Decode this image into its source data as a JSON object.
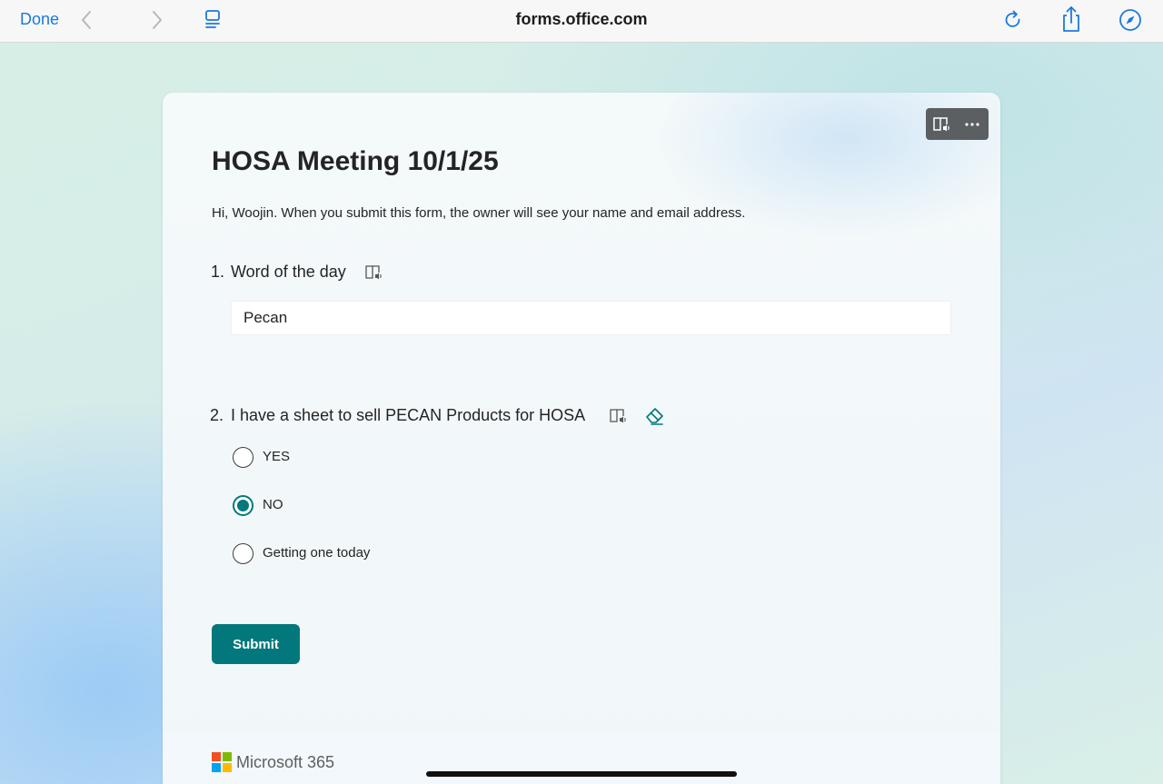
{
  "browser": {
    "done_label": "Done",
    "url": "forms.office.com",
    "accent_color": "#1a7ae0",
    "icons": [
      "back-chevron-icon",
      "forward-chevron-icon",
      "reader-icon",
      "reload-icon",
      "share-icon",
      "compass-icon"
    ]
  },
  "form": {
    "title": "HOSA Meeting 10/1/25",
    "description": "Hi, Woojin. When you submit this form, the owner will see your name and email address.",
    "toolbar_icons": [
      "immersive-reader-icon",
      "more-options-icon"
    ],
    "questions": [
      {
        "number": "1.",
        "title": "Word of the day",
        "type": "text",
        "value": "Pecan",
        "icons": [
          "immersive-reader-icon"
        ]
      },
      {
        "number": "2.",
        "title": "I have a sheet to sell PECAN Products for HOSA",
        "type": "choice",
        "icons": [
          "immersive-reader-icon",
          "eraser-icon"
        ],
        "options": [
          {
            "label": "YES",
            "selected": false
          },
          {
            "label": "NO",
            "selected": true
          },
          {
            "label": "Getting one today",
            "selected": false
          }
        ]
      }
    ],
    "submit_label": "Submit",
    "theme_color": "#03787c"
  },
  "footer": {
    "brand": "Microsoft 365",
    "logo_colors": [
      "#f25022",
      "#7fba00",
      "#00a4ef",
      "#ffb900"
    ]
  }
}
